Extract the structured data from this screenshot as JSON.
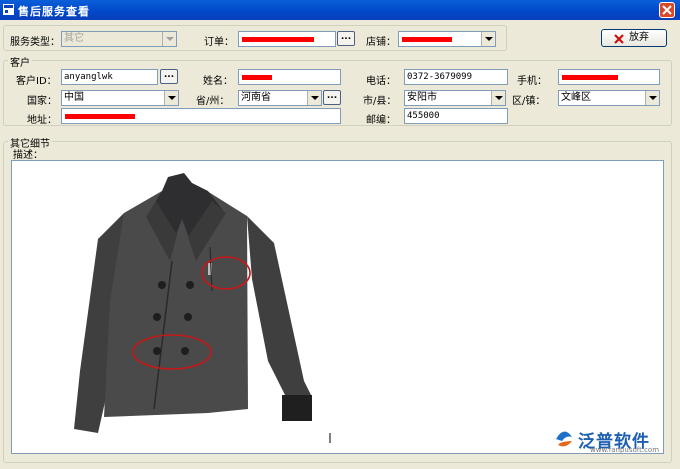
{
  "window": {
    "title": "售后服务查看"
  },
  "top": {
    "service_type_label": "服务类型：",
    "service_type_value": "其它",
    "order_label": "订单：",
    "shop_label": "店铺：",
    "dots_label": "...",
    "abandon_label": "放弃"
  },
  "customer": {
    "group_title": "客户",
    "id_label": "客户ID：",
    "id_value": "anyanglwk",
    "name_label": "姓名：",
    "phone_label": "电话：",
    "phone_value": "0372-3679099",
    "mobile_label": "手机：",
    "country_label": "国家：",
    "country_value": "中国",
    "province_label": "省/州：",
    "province_value": "河南省",
    "city_label": "市/县：",
    "city_value": "安阳市",
    "district_label": "区/镇：",
    "district_value": "文峰区",
    "address_label": "地址：",
    "postcode_label": "邮编：",
    "postcode_value": "455000"
  },
  "details": {
    "group_title": "其它细节",
    "desc_label": "描述："
  },
  "watermark": {
    "brand": "泛普软件",
    "url": "www.fanpusoft.com"
  },
  "colors": {
    "title_bar": "#0147c9",
    "redaction": "#ff0000",
    "window_bg": "#ece9d8"
  }
}
